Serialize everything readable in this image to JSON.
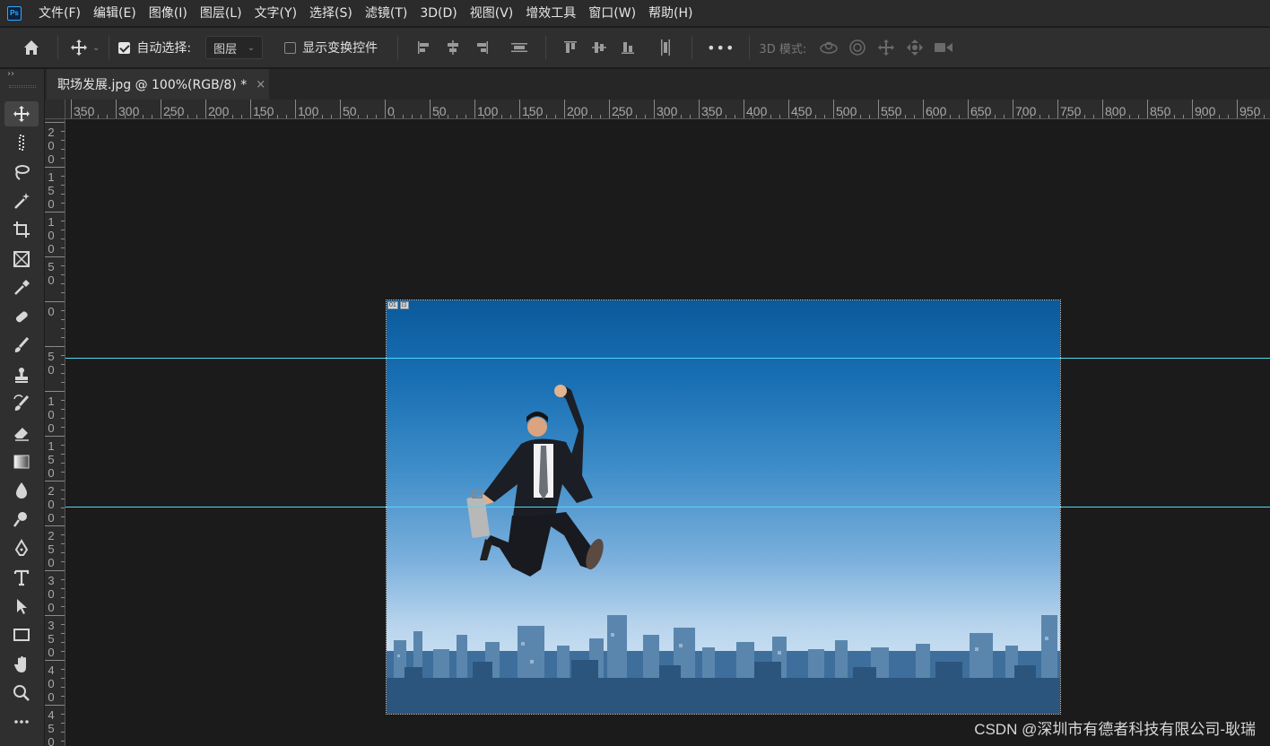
{
  "app": {
    "logo": "Ps"
  },
  "menu": [
    {
      "label": "文件(F)"
    },
    {
      "label": "编辑(E)"
    },
    {
      "label": "图像(I)"
    },
    {
      "label": "图层(L)"
    },
    {
      "label": "文字(Y)"
    },
    {
      "label": "选择(S)"
    },
    {
      "label": "滤镜(T)"
    },
    {
      "label": "3D(D)"
    },
    {
      "label": "视图(V)"
    },
    {
      "label": "增效工具"
    },
    {
      "label": "窗口(W)"
    },
    {
      "label": "帮助(H)"
    }
  ],
  "options": {
    "auto_select_label": "自动选择:",
    "auto_select_checked": true,
    "auto_select_target": "图层",
    "show_transform_label": "显示变换控件",
    "show_transform_checked": false,
    "more": "•••",
    "mode_3d_label": "3D 模式:"
  },
  "document": {
    "tab_title": "职场发展.jpg @ 100%(RGB/8) *",
    "close": "×",
    "layer_badge": [
      "01",
      "⊡"
    ]
  },
  "ruler_h_labels": [
    "350",
    "300",
    "250",
    "200",
    "150",
    "100",
    "50",
    "0",
    "50",
    "100",
    "150",
    "200",
    "250",
    "300",
    "350",
    "400",
    "450",
    "500",
    "550",
    "600",
    "650",
    "700",
    "750",
    "800",
    "850",
    "900",
    "950"
  ],
  "ruler_v_labels": [
    [
      "2",
      "0",
      "0"
    ],
    [
      "1",
      "5",
      "0"
    ],
    [
      "1",
      "0",
      "0"
    ],
    [
      "5",
      "0"
    ],
    [
      "0"
    ],
    [
      "5",
      "0"
    ],
    [
      "1",
      "0",
      "0"
    ],
    [
      "1",
      "5",
      "0"
    ],
    [
      "2",
      "0",
      "0"
    ],
    [
      "2",
      "5",
      "0"
    ],
    [
      "3",
      "0",
      "0"
    ],
    [
      "3",
      "5",
      "0"
    ],
    [
      "4",
      "0",
      "0"
    ],
    [
      "4",
      "5",
      "0"
    ]
  ],
  "tools": [
    {
      "name": "move-tool-icon"
    },
    {
      "name": "marquee-tool-icon"
    },
    {
      "name": "lasso-tool-icon"
    },
    {
      "name": "magic-wand-tool-icon"
    },
    {
      "name": "crop-tool-icon"
    },
    {
      "name": "frame-tool-icon"
    },
    {
      "name": "eyedropper-tool-icon"
    },
    {
      "name": "healing-brush-tool-icon"
    },
    {
      "name": "brush-tool-icon"
    },
    {
      "name": "clone-stamp-tool-icon"
    },
    {
      "name": "history-brush-tool-icon"
    },
    {
      "name": "eraser-tool-icon"
    },
    {
      "name": "gradient-tool-icon"
    },
    {
      "name": "blur-tool-icon"
    },
    {
      "name": "dodge-tool-icon"
    },
    {
      "name": "pen-tool-icon"
    },
    {
      "name": "type-tool-icon"
    },
    {
      "name": "path-selection-tool-icon"
    },
    {
      "name": "rectangle-tool-icon"
    },
    {
      "name": "hand-tool-icon"
    },
    {
      "name": "zoom-tool-icon"
    },
    {
      "name": "more-tools-icon"
    }
  ],
  "watermark": "CSDN @深圳市有德者科技有限公司-耿瑞",
  "colors": {
    "guide": "#4fd9f2",
    "accent": "#31a8ff",
    "background": "#1b1b1b"
  }
}
